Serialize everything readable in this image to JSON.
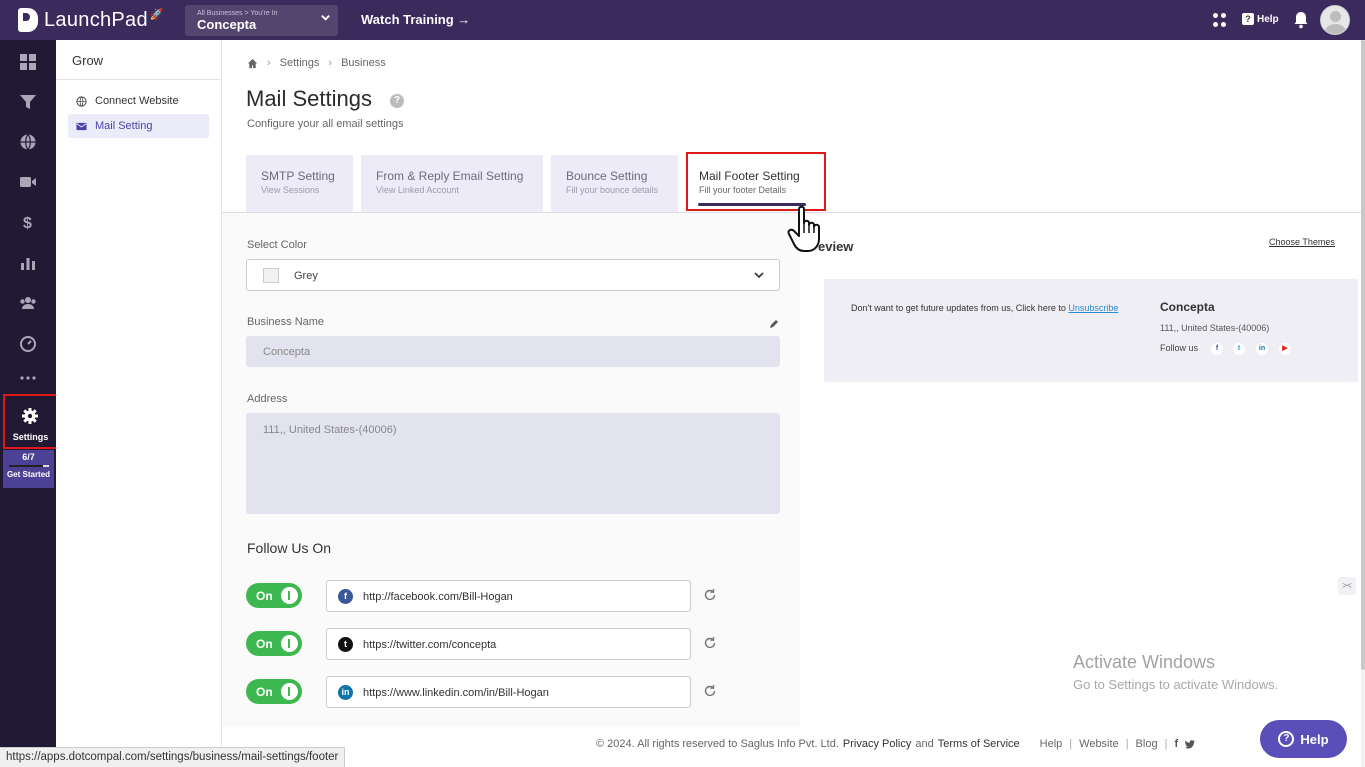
{
  "app": {
    "logo": "LaunchPad",
    "business_crumb": "All Businesses > You're In",
    "business_name": "Concepta",
    "watch_training": "Watch Training →",
    "help": "Help"
  },
  "rail": {
    "settings_label": "Settings",
    "progress_text": "6/7",
    "progress_fraction": 0.857,
    "get_started": "Get Started"
  },
  "subnav": {
    "title": "Grow",
    "items": [
      {
        "label": "Connect Website",
        "icon": "globe-icon"
      },
      {
        "label": "Mail Setting",
        "icon": "mail-icon",
        "active": true
      }
    ]
  },
  "breadcrumb": [
    "Settings",
    "Business"
  ],
  "page": {
    "title": "Mail Settings",
    "subtitle": "Configure your all email settings"
  },
  "tabs": [
    {
      "title": "SMTP Setting",
      "sub": "View Sessions"
    },
    {
      "title": "From & Reply Email Setting",
      "sub": "View Linked Account"
    },
    {
      "title": "Bounce Setting",
      "sub": "Fill your bounce details"
    },
    {
      "title": "Mail Footer Setting",
      "sub": "Fill your footer Details",
      "active": true
    }
  ],
  "form": {
    "color_label": "Select Color",
    "color_value": "Grey",
    "business_label": "Business Name",
    "business_value": "Concepta",
    "address_label": "Address",
    "address_value": "111,, United States-(40006)",
    "follow_title": "Follow Us On",
    "toggle_label": "On",
    "socials": [
      {
        "network": "facebook",
        "glyph": "f",
        "color": "#3b5998",
        "url": "http://facebook.com/Bill-Hogan"
      },
      {
        "network": "twitter",
        "glyph": "t",
        "color": "#111111",
        "url": "https://twitter.com/concepta"
      },
      {
        "network": "linkedin",
        "glyph": "in",
        "color": "#0e76a8",
        "url": "https://www.linkedin.com/in/Bill-Hogan"
      }
    ]
  },
  "preview": {
    "title": "eview",
    "choose_themes": "Choose Themes",
    "unsub_text": "Don't want to get future updates from us, Click here to ",
    "unsub_link": "Unsubscribe",
    "business": "Concepta",
    "address": "111,, United States-(40006)",
    "follow_label": "Follow us"
  },
  "watermark": {
    "line1": "Activate Windows",
    "line2": "Go to Settings to activate Windows."
  },
  "footer": {
    "copyright": "©  2024. All rights reserved to Saglus Info Pvt. Ltd.",
    "privacy": "Privacy Policy",
    "and": "and",
    "terms": "Terms of Service",
    "links": [
      "Help",
      "Website",
      "Blog"
    ]
  },
  "help_fab": "Help",
  "status_url": "https://apps.dotcompal.com/settings/business/mail-settings/footer",
  "colors": {
    "topbar": "#3b2a5c",
    "rail": "#221a35",
    "accent": "#5a4fb8",
    "toggle_on": "#3db74f",
    "highlight": "#e01818"
  }
}
